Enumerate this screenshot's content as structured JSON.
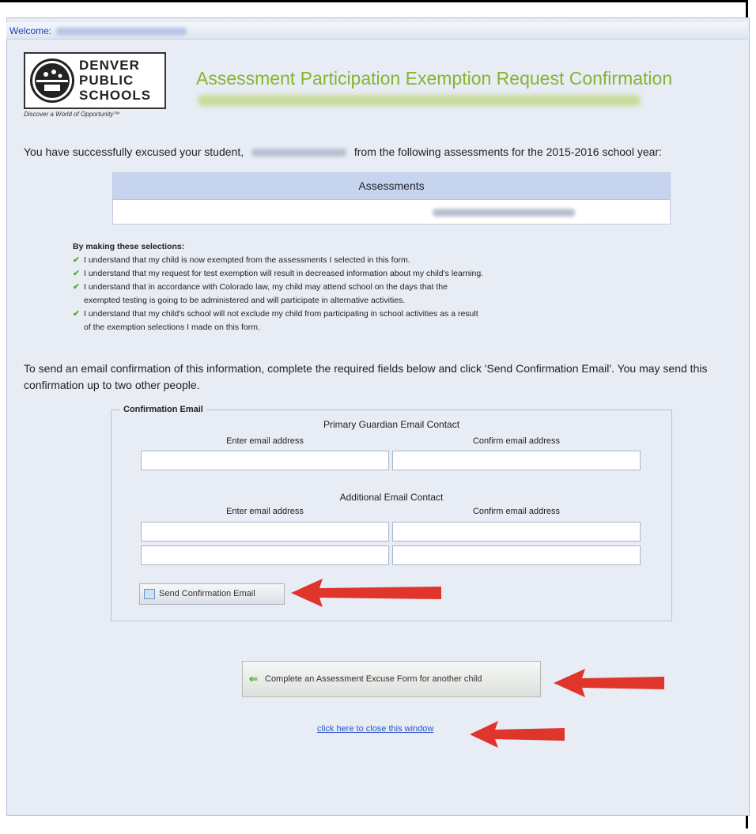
{
  "welcome": {
    "label": "Welcome:"
  },
  "logo": {
    "line1": "DENVER",
    "line2": "PUBLIC",
    "line3": "SCHOOLS",
    "tagline": "Discover a World of Opportunity™"
  },
  "header": {
    "title": "Assessment Participation Exemption Request Confirmation"
  },
  "success": {
    "prefix": "You have successfully excused your student,",
    "suffix": "from the following assessments for the 2015-2016 school year:"
  },
  "assessments": {
    "header": "Assessments"
  },
  "acknowledgements": {
    "title": "By making these selections:",
    "items": [
      "I understand that my child is now exempted from the assessments I selected in this form.",
      "I understand that my request for test exemption will result in decreased information about my child's learning.",
      "I understand that in accordance with Colorado law, my child may attend school on the days that the",
      "exempted testing is going to be administered and will participate in alternative activities.",
      "I understand that my child's school will not exclude my child from participating in school activities as a result",
      "of the exemption selections I made on this form."
    ]
  },
  "instructions": "To send an email confirmation of this information, complete the required fields below and click 'Send Confirmation Email'. You may send this confirmation up to two other people.",
  "confirmation_email": {
    "legend": "Confirmation Email",
    "primary_heading": "Primary Guardian Email Contact",
    "additional_heading": "Additional Email Contact",
    "enter_label": "Enter email address",
    "confirm_label": "Confirm email address",
    "send_button": "Send Confirmation Email"
  },
  "another_child_button": "Complete an Assessment Excuse Form for another child",
  "close_link": "click here to close this window",
  "colors": {
    "title_green": "#86b52f",
    "arrow_red": "#e0352b",
    "link_blue": "#2a55c8",
    "panel_bg": "#e7ecf5"
  },
  "icons": {
    "check": "check-icon",
    "arrow": "red-arrow-icon",
    "back": "green-arrow-icon"
  }
}
